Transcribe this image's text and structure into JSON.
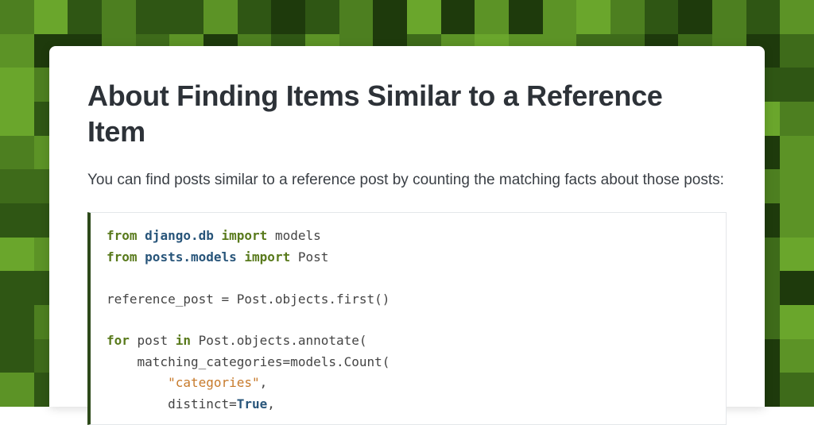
{
  "heading": "About Finding Items Similar to a Reference Item",
  "lead": "You can find posts similar to a reference post by counting the matching facts about those posts:",
  "code": {
    "l1_from": "from",
    "l1_mod": "django.db",
    "l1_import": "import",
    "l1_rest": " models",
    "l2_from": "from",
    "l2_mod": "posts.models",
    "l2_import": "import",
    "l2_rest": " Post",
    "l4": "reference_post = Post.objects.first()",
    "l6_for": "for",
    "l6_mid": " post ",
    "l6_in": "in",
    "l6_rest": " Post.objects.annotate(",
    "l7": "    matching_categories=models.Count(",
    "l8_indent": "        ",
    "l8_str": "\"categories\"",
    "l8_comma": ",",
    "l9_indent": "        distinct=",
    "l9_bool": "True",
    "l9_comma": ","
  }
}
